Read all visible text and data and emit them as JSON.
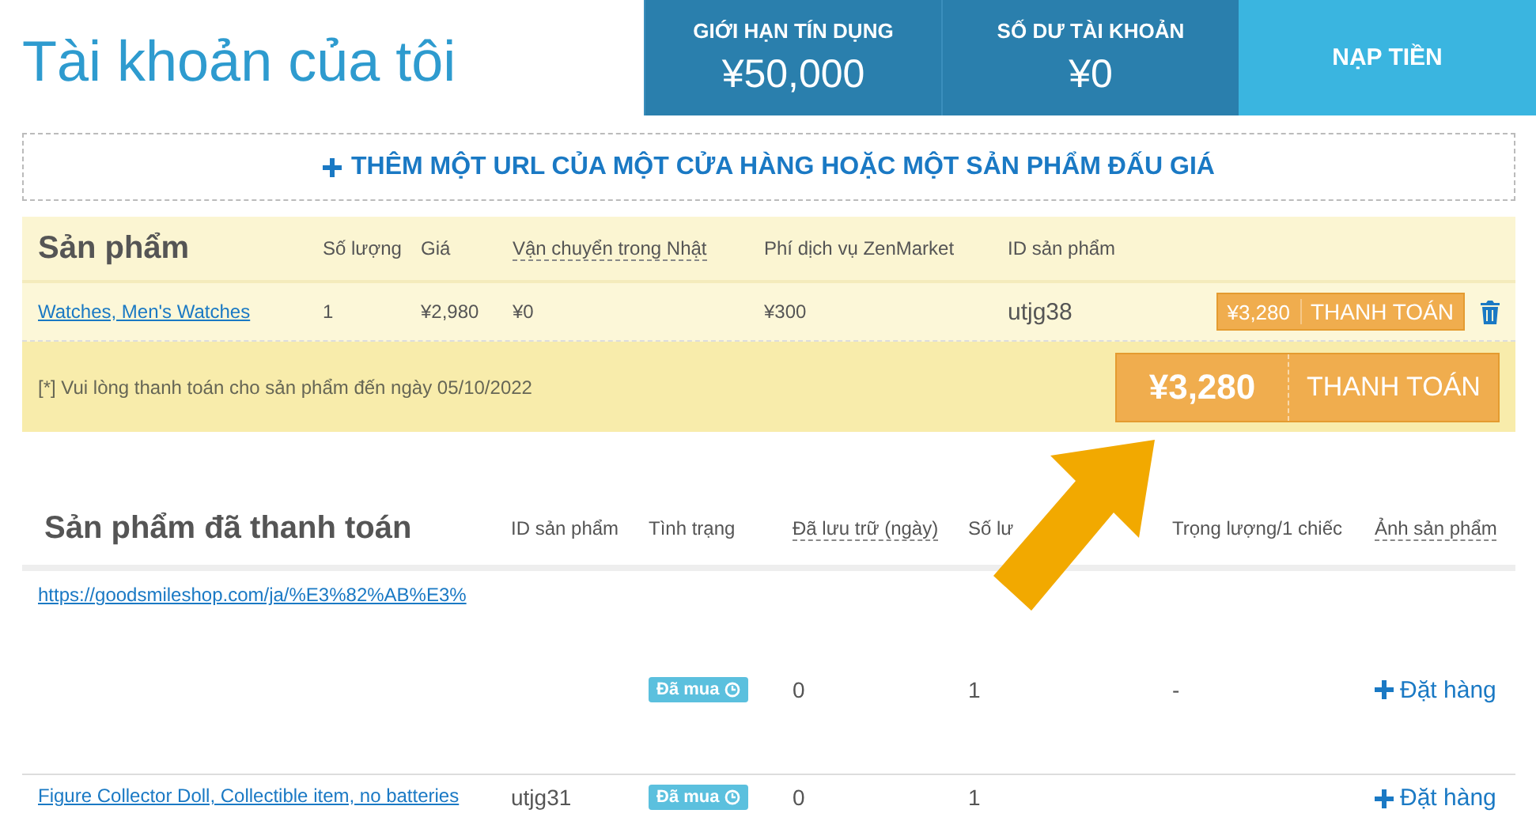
{
  "header": {
    "title": "Tài khoản của tôi",
    "stats": [
      {
        "label": "GIỚI HẠN TÍN DỤNG",
        "value": "¥50,000"
      },
      {
        "label": "SỐ DƯ TÀI KHOẢN",
        "value": "¥0"
      }
    ],
    "topup_button": "NẠP TIỀN"
  },
  "add_url_button": "THÊM MỘT URL CỦA MỘT CỬA HÀNG HOẶC MỘT SẢN PHẨM ĐẤU GIÁ",
  "cart": {
    "title": "Sản phẩm",
    "columns": [
      {
        "label": "Số lượng",
        "dashed": false
      },
      {
        "label": "Giá",
        "dashed": false
      },
      {
        "label": "Vận chuyển trong Nhật",
        "dashed": true
      },
      {
        "label": "Phí dịch vụ ZenMarket",
        "dashed": false
      },
      {
        "label": "ID sản phẩm",
        "dashed": false
      }
    ],
    "items": [
      {
        "name": "Watches, Men's Watches",
        "quantity": "1",
        "price": "¥2,980",
        "shipping": "¥0",
        "fee": "¥300",
        "product_id": "utjg38",
        "total": "¥3,280",
        "pay_label": "THANH TOÁN"
      }
    ],
    "note": "[*] Vui lòng thanh toán cho sản phẩm đến ngày 05/10/2022",
    "total": "¥3,280",
    "pay_label": "THANH TOÁN"
  },
  "paid": {
    "title": "Sản phẩm đã thanh toán",
    "columns": [
      {
        "label": "ID sản phẩm",
        "dashed": false
      },
      {
        "label": "Tình trạng",
        "dashed": false
      },
      {
        "label": "Đã lưu trữ (ngày)",
        "dashed": true
      },
      {
        "label": "Số lư",
        "dashed": false
      },
      {
        "label": "Trọng lượng/1 chiếc",
        "dashed": false
      },
      {
        "label": "Ảnh sản phẩm",
        "dashed": true
      }
    ],
    "rows": [
      {
        "link": "https://goodsmileshop.com/ja/%E3%82%AB%E3%",
        "status": "Đã mua",
        "stored_days": "0",
        "quantity": "1",
        "weight": "-",
        "action": "Đặt hàng"
      },
      {
        "link": "Figure Collector Doll, Collectible item, no batteries",
        "product_id": "utjg31",
        "status": "Đã mua",
        "stored_days": "0",
        "quantity": "1",
        "action": "Đặt hàng"
      }
    ]
  }
}
